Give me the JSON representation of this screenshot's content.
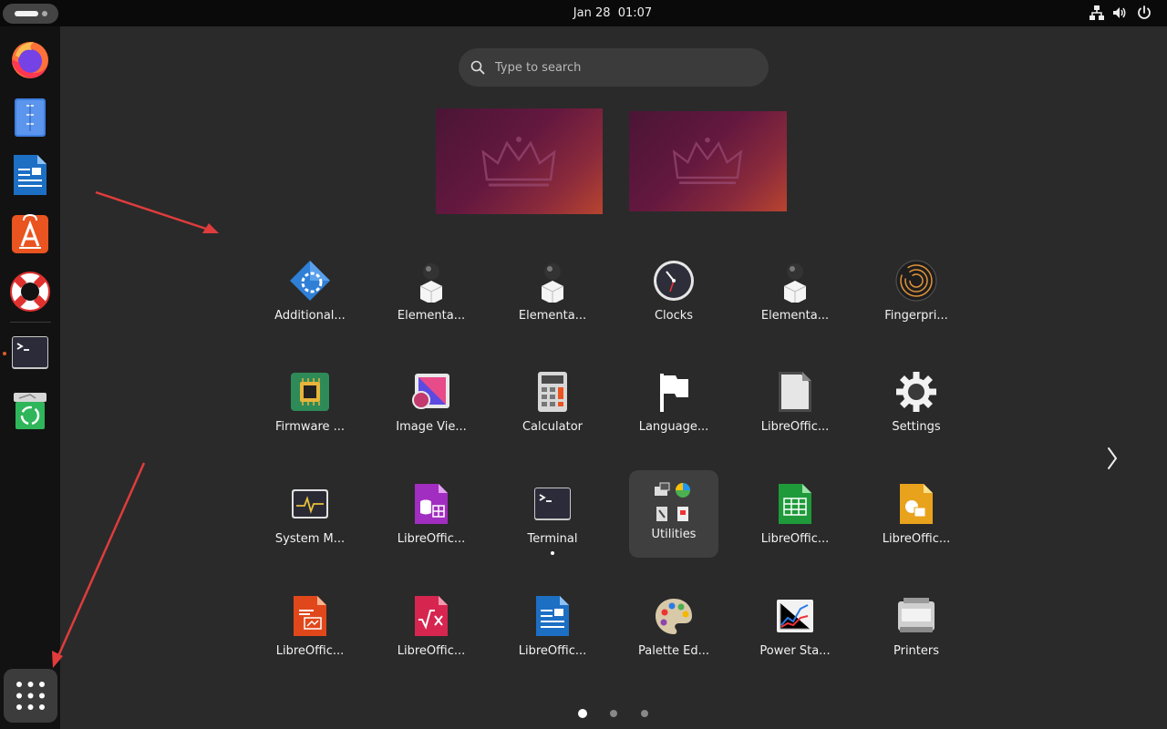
{
  "topbar": {
    "clock": "Jan 28  01:07"
  },
  "search": {
    "placeholder": "Type to search"
  },
  "apps": [
    {
      "label": "Additional...",
      "icon": "software-properties-icon"
    },
    {
      "label": "Elementa...",
      "icon": "elementary-icon"
    },
    {
      "label": "Elementa...",
      "icon": "elementary-icon"
    },
    {
      "label": "Clocks",
      "icon": "clock-icon"
    },
    {
      "label": "Elementa...",
      "icon": "elementary-icon"
    },
    {
      "label": "Fingerpri...",
      "icon": "fingerprint-icon"
    },
    {
      "label": "Firmware ...",
      "icon": "firmware-chip-icon"
    },
    {
      "label": "Image Vie...",
      "icon": "image-viewer-icon"
    },
    {
      "label": "Calculator",
      "icon": "calculator-icon"
    },
    {
      "label": "Language...",
      "icon": "flag-icon"
    },
    {
      "label": "LibreOffic...",
      "icon": "libreoffice-document-icon"
    },
    {
      "label": "Settings",
      "icon": "gear-icon"
    },
    {
      "label": "System M...",
      "icon": "system-monitor-icon"
    },
    {
      "label": "LibreOffic...",
      "icon": "libreoffice-base-icon"
    },
    {
      "label": "Terminal",
      "icon": "terminal-icon"
    },
    {
      "label": "Utilities",
      "icon": "folder-utilities-icon"
    },
    {
      "label": "LibreOffic...",
      "icon": "libreoffice-calc-icon"
    },
    {
      "label": "LibreOffic...",
      "icon": "libreoffice-impress-icon"
    },
    {
      "label": "LibreOffic...",
      "icon": "libreoffice-draw-icon"
    },
    {
      "label": "LibreOffic...",
      "icon": "libreoffice-math-icon"
    },
    {
      "label": "LibreOffic...",
      "icon": "libreoffice-writer-icon"
    },
    {
      "label": "Palette Ed...",
      "icon": "palette-icon"
    },
    {
      "label": "Power Sta...",
      "icon": "power-statistics-icon"
    },
    {
      "label": "Printers",
      "icon": "printer-icon"
    }
  ],
  "dock": [
    "firefox-icon",
    "text-editor-icon",
    "libreoffice-writer-icon",
    "app-center-icon",
    "help-lifebuoy-icon",
    "terminal-icon",
    "trash-icon"
  ],
  "pagination": {
    "total": 3,
    "active": 1
  },
  "colors": {
    "accent_orange": "#e95420",
    "arrow_red": "#e03c3c"
  }
}
